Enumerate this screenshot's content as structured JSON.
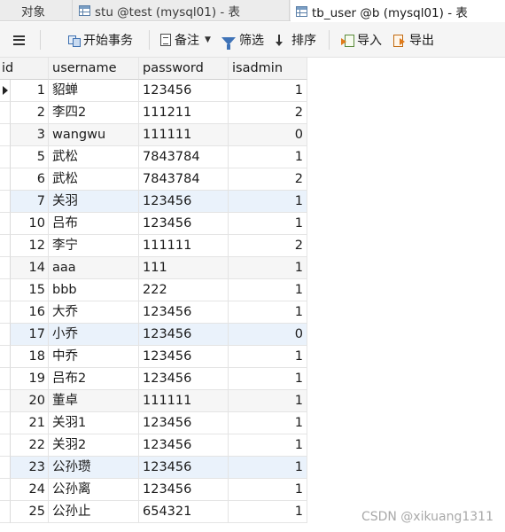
{
  "tabs": [
    {
      "label": "对象"
    },
    {
      "label": "stu @test (mysql01) - 表"
    },
    {
      "label": "tb_user @b (mysql01) - 表"
    }
  ],
  "toolbar": {
    "menu_icon": "hamburger-menu-icon",
    "begin_transaction": "开始事务",
    "note": "备注",
    "filter": "筛选",
    "sort": "排序",
    "import": "导入",
    "export": "导出"
  },
  "table": {
    "columns": [
      "id",
      "username",
      "password",
      "isadmin"
    ],
    "rows": [
      [
        "1",
        "貂蝉",
        "123456",
        "1"
      ],
      [
        "2",
        "李四2",
        "111211",
        "2"
      ],
      [
        "3",
        "wangwu",
        "111111",
        "0"
      ],
      [
        "5",
        "武松",
        "7843784",
        "1"
      ],
      [
        "6",
        "武松",
        "7843784",
        "2"
      ],
      [
        "7",
        "关羽",
        "123456",
        "1"
      ],
      [
        "10",
        "吕布",
        "123456",
        "1"
      ],
      [
        "12",
        "李宁",
        "111111",
        "2"
      ],
      [
        "14",
        "aaa",
        "111",
        "1"
      ],
      [
        "15",
        "bbb",
        "222",
        "1"
      ],
      [
        "16",
        "大乔",
        "123456",
        "1"
      ],
      [
        "17",
        "小乔",
        "123456",
        "0"
      ],
      [
        "18",
        "中乔",
        "123456",
        "1"
      ],
      [
        "19",
        "吕布2",
        "123456",
        "1"
      ],
      [
        "20",
        "董卓",
        "111111",
        "1"
      ],
      [
        "21",
        "关羽1",
        "123456",
        "1"
      ],
      [
        "22",
        "关羽2",
        "123456",
        "1"
      ],
      [
        "23",
        "公孙瓒",
        "123456",
        "1"
      ],
      [
        "24",
        "公孙离",
        "123456",
        "1"
      ],
      [
        "25",
        "公孙止",
        "654321",
        "1"
      ]
    ]
  },
  "watermark": "CSDN @xikuang1311"
}
